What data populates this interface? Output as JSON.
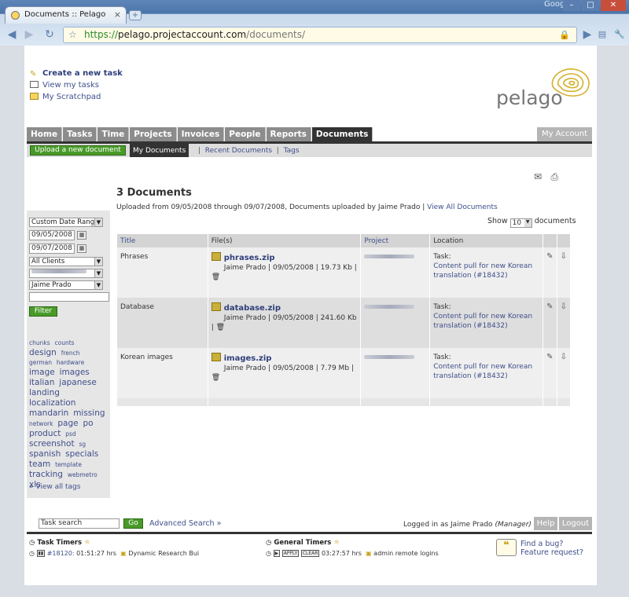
{
  "browser": {
    "tab_title": "Documents :: Pelago",
    "new_tab": "+",
    "brand": "Google",
    "url_scheme": "https://",
    "url_domain": "pelago.projectaccount.com",
    "url_path": "/documents/"
  },
  "quick_links": {
    "create_task": "Create a new task",
    "view_tasks": "View my tasks",
    "scratchpad": "My Scratchpad"
  },
  "logo": "pelago",
  "nav": {
    "items": [
      "Home",
      "Tasks",
      "Time",
      "Projects",
      "Invoices",
      "People",
      "Reports",
      "Documents"
    ],
    "active": "Documents",
    "my_account": "My Account"
  },
  "subnav": {
    "upload": "Upload a new document",
    "my_documents": "My Documents",
    "recent": "Recent Documents",
    "sep": "|",
    "tags": "Tags"
  },
  "filters": {
    "date_range": "Custom Date Range",
    "from": "09/05/2008",
    "to": "09/07/2008",
    "clients": "All Clients",
    "person": "Jaime Prado",
    "filter_btn": "Filter"
  },
  "tags": {
    "items": [
      {
        "t": "chunks",
        "s": 1
      },
      {
        "t": "counts",
        "s": 1
      },
      {
        "t": "design",
        "s": 3
      },
      {
        "t": "french",
        "s": 1
      },
      {
        "t": "german",
        "s": 1
      },
      {
        "t": "hardware",
        "s": 1
      },
      {
        "t": "image",
        "s": 3
      },
      {
        "t": "images",
        "s": 3
      },
      {
        "t": "italian",
        "s": 3
      },
      {
        "t": "japanese",
        "s": 3
      },
      {
        "t": "landing",
        "s": 3
      },
      {
        "t": "localization",
        "s": 3
      },
      {
        "t": "mandarin",
        "s": 3
      },
      {
        "t": "missing",
        "s": 3
      },
      {
        "t": "network",
        "s": 1
      },
      {
        "t": "page",
        "s": 3
      },
      {
        "t": "po",
        "s": 3
      },
      {
        "t": "product",
        "s": 3
      },
      {
        "t": "psd",
        "s": 1
      },
      {
        "t": "screenshot",
        "s": 3
      },
      {
        "t": "sg",
        "s": 1
      },
      {
        "t": "spanish",
        "s": 3
      },
      {
        "t": "specials",
        "s": 3
      },
      {
        "t": "team",
        "s": 3
      },
      {
        "t": "template",
        "s": 1
      },
      {
        "t": "tracking",
        "s": 3
      },
      {
        "t": "webmetro",
        "s": 1
      },
      {
        "t": "xls",
        "s": 3
      }
    ],
    "view_all": "» View all tags"
  },
  "main": {
    "title": "3 Documents",
    "subtitle": "Uploaded from 09/05/2008 through 09/07/2008, Documents uploaded by Jaime Prado |",
    "view_all": "View All Documents",
    "show_label": "Show",
    "show_value": "10",
    "show_suffix": "documents"
  },
  "table": {
    "headers": [
      "Title",
      "File(s)",
      "Project",
      "Location"
    ],
    "rows": [
      {
        "title": "Phrases",
        "file": "phrases.zip",
        "meta": "Jaime Prado | 09/05/2008 | 19.73 Kb |",
        "loc_label": "Task:",
        "loc_link": "Content pull for new Korean translation (#18432)"
      },
      {
        "title": "Database",
        "file": "database.zip",
        "meta": "Jaime Prado | 09/05/2008 | 241.60 Kb |",
        "loc_label": "Task:",
        "loc_link": "Content pull for new Korean translation (#18432)"
      },
      {
        "title": "Korean images",
        "file": "images.zip",
        "meta": "Jaime Prado | 09/05/2008 | 7.79 Mb |",
        "loc_label": "Task:",
        "loc_link": "Content pull for new Korean translation (#18432)"
      }
    ]
  },
  "footer": {
    "search_value": "Task search",
    "go": "Go",
    "advanced": "Advanced Search »",
    "logged_in": "Logged in as Jaime Prado",
    "role": "(Manager)",
    "help": "Help",
    "logout": "Logout"
  },
  "timers": {
    "task_title": "Task Timers",
    "task_id": "#18120:",
    "task_time": "01:51:27 hrs",
    "task_name": "Dynamic Research Bui",
    "general_title": "General Timers",
    "apply": "APPLY",
    "clear": "CLEAR",
    "general_time": "03:27:57 hrs",
    "general_name": "admin remote logins",
    "bug_line1": "Find a bug?",
    "bug_line2": "Feature request?"
  }
}
